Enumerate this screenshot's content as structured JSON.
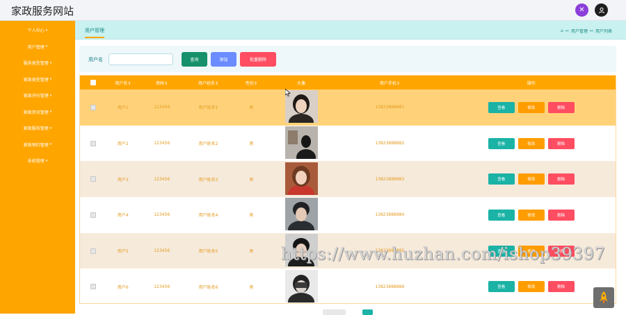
{
  "header": {
    "title": "家政服务网站"
  },
  "sidebar": {
    "items": [
      {
        "label": "个人中心"
      },
      {
        "label": "用户管理"
      },
      {
        "label": "服务类型管理"
      },
      {
        "label": "家政类型管理"
      },
      {
        "label": "家政评价管理"
      },
      {
        "label": "家政资讯管理"
      },
      {
        "label": "家政服务管理"
      },
      {
        "label": "家政预约管理"
      },
      {
        "label": "系统管理"
      }
    ]
  },
  "tabbar": {
    "active_tab": "用户管理",
    "breadcrumb": [
      "用户管理",
      "用户列表"
    ]
  },
  "search": {
    "label": "用户名",
    "input_value": "",
    "query_label": "查询",
    "add_label": "添加",
    "batch_delete_label": "批量删除"
  },
  "table": {
    "headers": [
      "用户名⇕",
      "密码⇕",
      "用户姓名⇕",
      "性别⇕",
      "头像",
      "用户手机⇕",
      "操作"
    ],
    "action_labels": {
      "view": "查看",
      "edit": "修改",
      "delete": "删除"
    },
    "rows": [
      {
        "username": "用户1",
        "password": "123456",
        "name": "用户姓名1",
        "gender": "男",
        "phone": "13823888881"
      },
      {
        "username": "用户2",
        "password": "123456",
        "name": "用户姓名2",
        "gender": "男",
        "phone": "13823888882"
      },
      {
        "username": "用户3",
        "password": "123456",
        "name": "用户姓名3",
        "gender": "男",
        "phone": "13823888883"
      },
      {
        "username": "用户4",
        "password": "123456",
        "name": "用户姓名4",
        "gender": "男",
        "phone": "13823888884"
      },
      {
        "username": "用户5",
        "password": "123456",
        "name": "用户姓名5",
        "gender": "男",
        "phone": "13823888885"
      },
      {
        "username": "用户6",
        "password": "123456",
        "name": "用户姓名6",
        "gender": "男",
        "phone": "13823888886"
      }
    ]
  },
  "watermark": "https://www.huzhan.com/ishop39397",
  "colors": {
    "accent": "#ffa500",
    "teal": "#1ab3a6",
    "query_button": "#17916b",
    "add_button": "#6a8cff",
    "delete_button": "#ff4d61",
    "edit_button": "#ff9d00",
    "row_selected": "#ffd27a",
    "row_alt": "#f6eadb"
  }
}
